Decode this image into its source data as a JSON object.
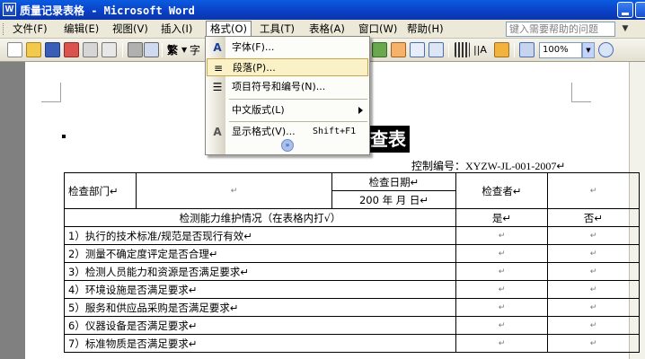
{
  "window": {
    "title": "质量记录表格 - Microsoft Word"
  },
  "menubar": {
    "items": [
      "文件(F)",
      "编辑(E)",
      "视图(V)",
      "插入(I)",
      "格式(O)",
      "工具(T)",
      "表格(A)",
      "窗口(W)",
      "帮助(H)"
    ],
    "help_placeholder": "键入需要帮助的问题"
  },
  "toolbar": {
    "style_label": "繁",
    "zoom": "100%"
  },
  "format_menu": {
    "items": [
      {
        "label": "字体(F)...",
        "icon": "font-A-icon"
      },
      {
        "label": "段落(P)...",
        "icon": "paragraph-icon"
      },
      {
        "label": "项目符号和编号(N)...",
        "icon": "bullets-icon"
      },
      {
        "label": "中文版式(L)",
        "icon": ""
      },
      {
        "label": "显示格式(V)...",
        "icon": "reveal-formatting-icon",
        "shortcut": "Shift+F1"
      }
    ]
  },
  "document": {
    "title": "查表",
    "control_no": "控制编号：XYZW-JL-001-2007↵",
    "table": {
      "dept_label": "检查部门↵",
      "date_label": "检查日期↵",
      "date_value": "200  年  月  日↵",
      "inspector_label": "检查者↵",
      "section_title": "检测能力维护情况（在表格内打√）",
      "yes": "是↵",
      "no": "否↵",
      "rows": [
        "1）执行的技术标准/规范是否现行有效↵",
        "2）测量不确定度评定是否合理↵",
        "3）检测人员能力和资源是否满足要求↵",
        "4）环境设施是否满足要求↵",
        "5）服务和供应品采购是否满足要求↵",
        "6）仪器设备是否满足要求↵",
        "7）标准物质是否满足要求↵"
      ],
      "cell_mark": "↵"
    }
  }
}
